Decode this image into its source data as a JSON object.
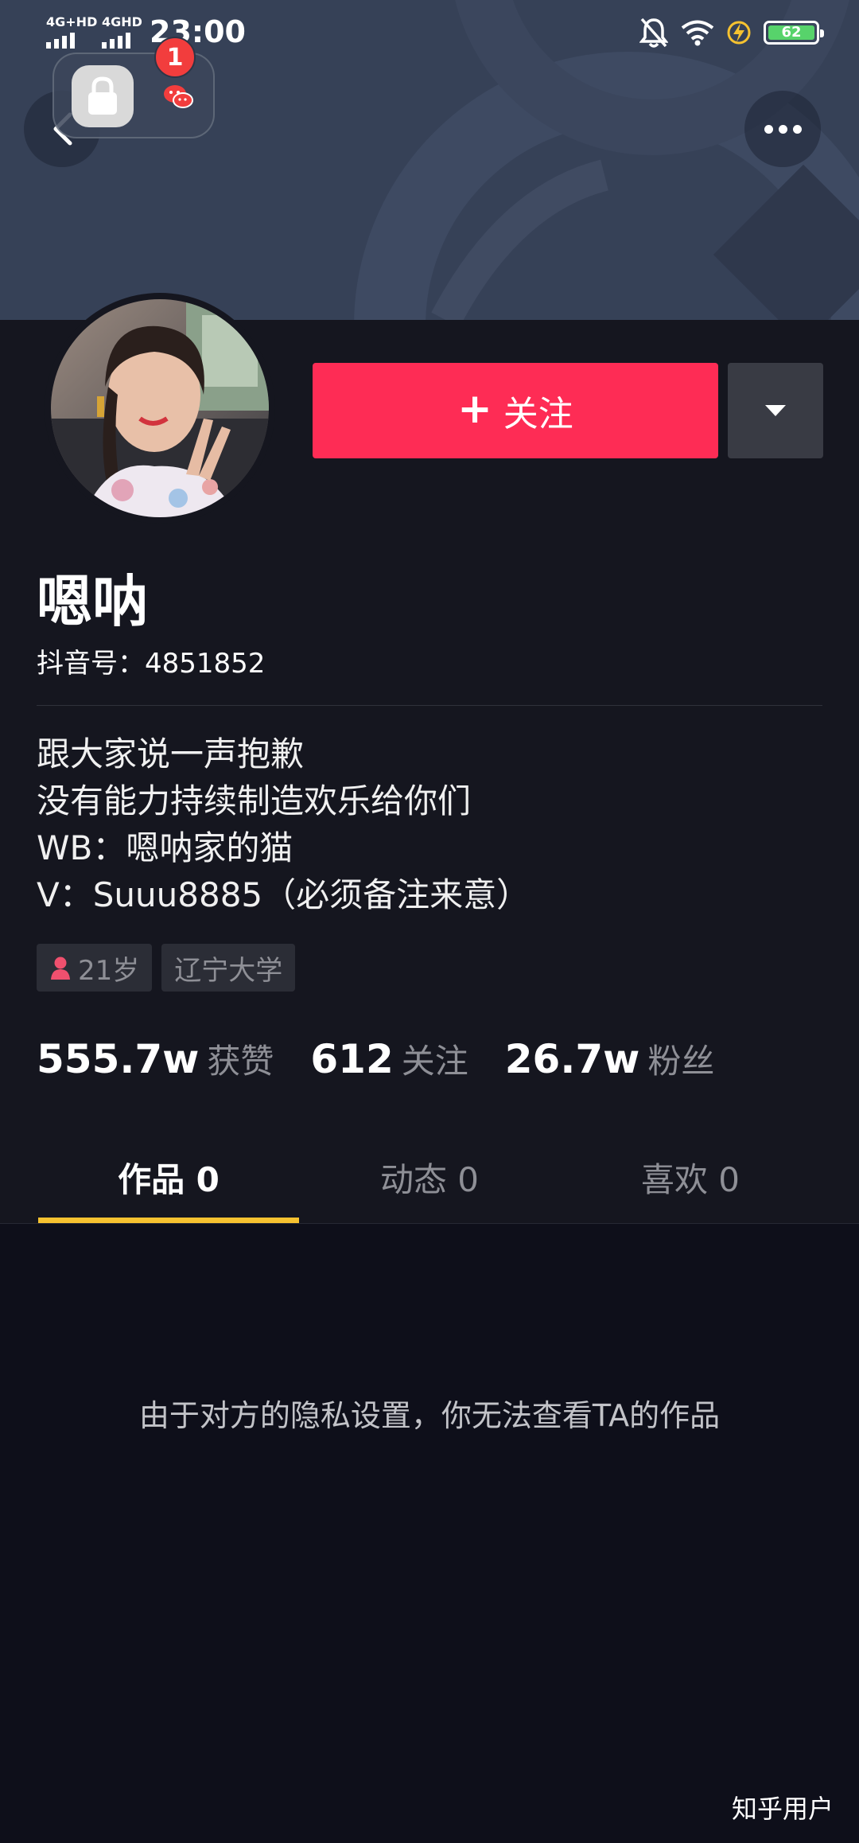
{
  "status_bar": {
    "sim1": "4G+HD",
    "sim2": "4GHD",
    "time": "23:00",
    "battery": "62",
    "icons": [
      "bell-off-icon",
      "wifi-icon",
      "charging-icon",
      "battery-icon"
    ]
  },
  "overlay": {
    "badge_count": "1",
    "icons": [
      "lock-icon",
      "wechat-icon"
    ]
  },
  "header": {
    "back_icon": "chevron-left-icon",
    "more_icon": "more-dots-icon"
  },
  "actions": {
    "follow_plus": "+",
    "follow_label": "关注",
    "dropdown_icon": "caret-down-icon"
  },
  "profile": {
    "name": "嗯呐",
    "douyin_id": "抖音号：4851852",
    "bio": [
      "跟大家说一声抱歉",
      "没有能力持续制造欢乐给你们",
      "WB：嗯呐家的猫",
      "V：Suuu8885（必须备注来意）"
    ],
    "tags": [
      {
        "icon": "female-icon",
        "label": "21岁"
      },
      {
        "label": "辽宁大学"
      }
    ]
  },
  "stats": [
    {
      "value": "555.7w",
      "label": "获赞"
    },
    {
      "value": "612",
      "label": "关注"
    },
    {
      "value": "26.7w",
      "label": "粉丝"
    }
  ],
  "tabs": [
    {
      "label": "作品 0",
      "active": true
    },
    {
      "label": "动态 0",
      "active": false
    },
    {
      "label": "喜欢 0",
      "active": false
    }
  ],
  "content": {
    "privacy_message": "由于对方的隐私设置，你无法查看TA的作品"
  },
  "watermark": "知乎用户",
  "colors": {
    "accent": "#fe2c55",
    "tab_indicator": "#f6c230",
    "background": "#15161f"
  }
}
